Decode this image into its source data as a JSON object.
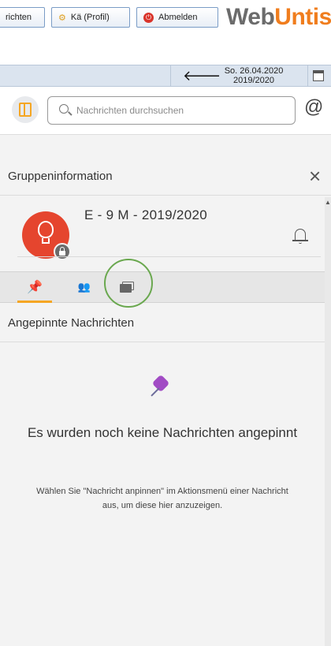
{
  "topbar": {
    "messages_button": "richten",
    "profile_button": "Kä (Profil)",
    "logout_button": "Abmelden",
    "brand_part1": "Web",
    "brand_part2": "Untis"
  },
  "datebar": {
    "date": "So. 26.04.2020",
    "schoolyear": "2019/2020"
  },
  "search": {
    "placeholder": "Nachrichten durchsuchen",
    "at_symbol": "@"
  },
  "panel": {
    "title": "Gruppeninformation",
    "close": "×",
    "group_name": "E - 9 M - 2019/2020",
    "tabs": [
      "pinned",
      "members",
      "media"
    ],
    "section_title": "Angepinnte Nachrichten",
    "empty_title": "Es wurden noch keine Nachrichten angepinnt",
    "empty_hint": "Wählen Sie \"Nachricht anpinnen\" im Aktionsmenü einer Nachricht aus, um diese hier anzuzeigen."
  },
  "colors": {
    "accent": "#f5a623",
    "avatar": "#e5452e",
    "annotation_circle": "#6aa84f",
    "pin": "#a14bc4"
  }
}
